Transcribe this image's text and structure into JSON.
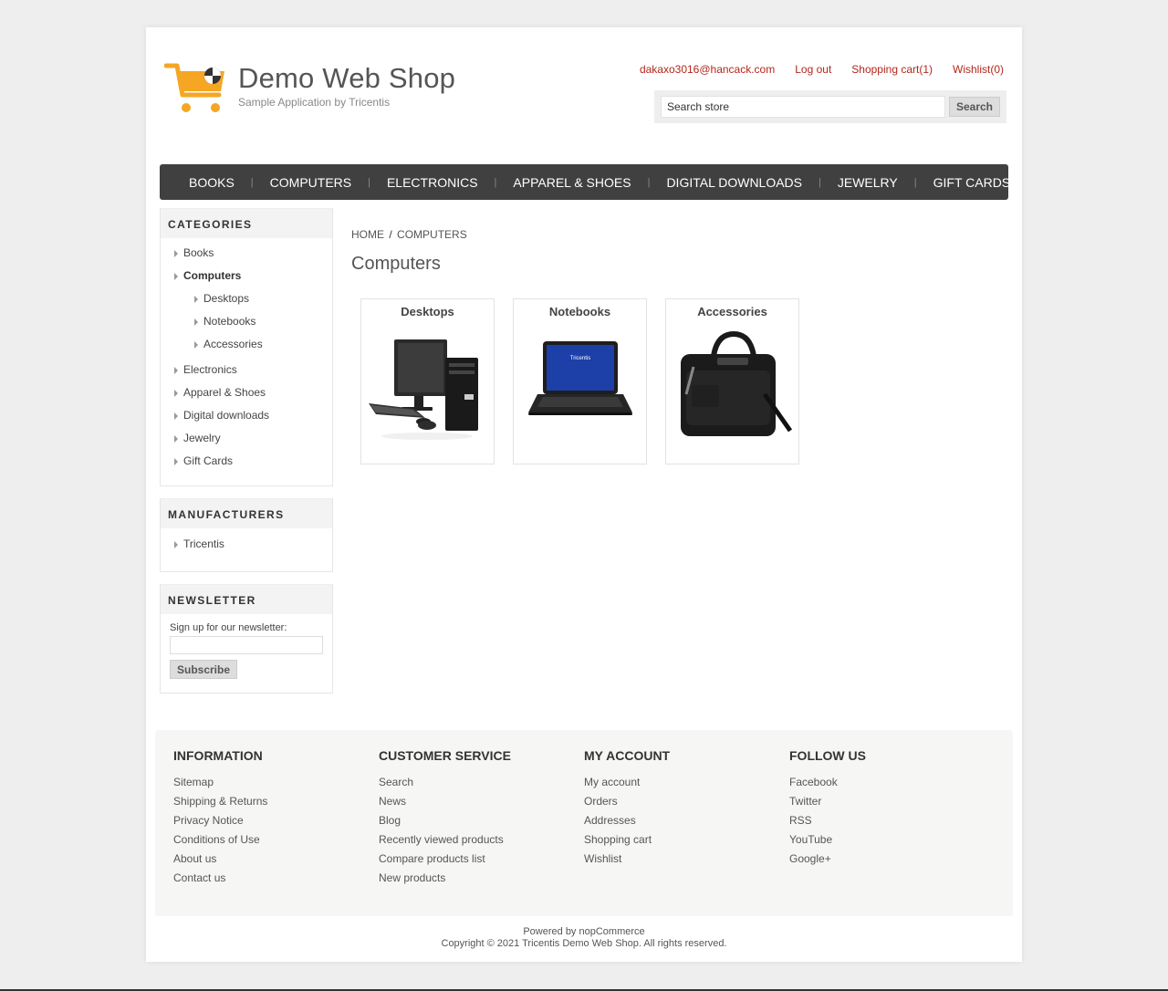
{
  "header": {
    "logo_title": "Demo Web Shop",
    "logo_subtitle": "Sample Application by Tricentis",
    "links": {
      "account_email": "dakaxo3016@hancack.com",
      "logout": "Log out",
      "shopping_cart": "Shopping cart(1)",
      "wishlist": "Wishlist(0)"
    },
    "search": {
      "value": "Search store",
      "button_label": "Search"
    }
  },
  "topmenu": {
    "items": [
      "BOOKS",
      "COMPUTERS",
      "ELECTRONICS",
      "APPAREL & SHOES",
      "DIGITAL DOWNLOADS",
      "JEWELRY",
      "GIFT CARDS"
    ]
  },
  "sidebar": {
    "categories": {
      "title": "CATEGORIES",
      "items": [
        "Books",
        "Computers",
        "Desktops",
        "Notebooks",
        "Accessories",
        "Electronics",
        "Apparel & Shoes",
        "Digital downloads",
        "Jewelry",
        "Gift Cards"
      ]
    },
    "manufacturers": {
      "title": "MANUFACTURERS",
      "items": [
        "Tricentis"
      ]
    },
    "newsletter": {
      "title": "NEWSLETTER",
      "label": "Sign up for our newsletter:",
      "input_value": "",
      "button_label": "Subscribe"
    }
  },
  "main": {
    "breadcrumb": {
      "home": "HOME",
      "separator": "/",
      "current": "COMPUTERS"
    },
    "title": "Computers",
    "subcategories": [
      "Desktops",
      "Notebooks",
      "Accessories"
    ]
  },
  "footer": {
    "information": {
      "title": "INFORMATION",
      "items": [
        "Sitemap",
        "Shipping & Returns",
        "Privacy Notice",
        "Conditions of Use",
        "About us",
        "Contact us"
      ]
    },
    "customer_service": {
      "title": "CUSTOMER SERVICE",
      "items": [
        "Search",
        "News",
        "Blog",
        "Recently viewed products",
        "Compare products list",
        "New products"
      ]
    },
    "my_account": {
      "title": "MY ACCOUNT",
      "items": [
        "My account",
        "Orders",
        "Addresses",
        "Shopping cart",
        "Wishlist"
      ]
    },
    "follow_us": {
      "title": "FOLLOW US",
      "items": [
        "Facebook",
        "Twitter",
        "RSS",
        "YouTube",
        "Google+"
      ]
    },
    "powered_by": "Powered by nopCommerce",
    "copyright": "Copyright © 2021 Tricentis Demo Web Shop. All rights reserved."
  },
  "colors": {
    "link_red": "#b3271c",
    "menu_bg": "#404040",
    "logo_orange": "#f5a623"
  },
  "icons": [
    "shopping-cart-logo-icon",
    "chevron-right-icon"
  ]
}
